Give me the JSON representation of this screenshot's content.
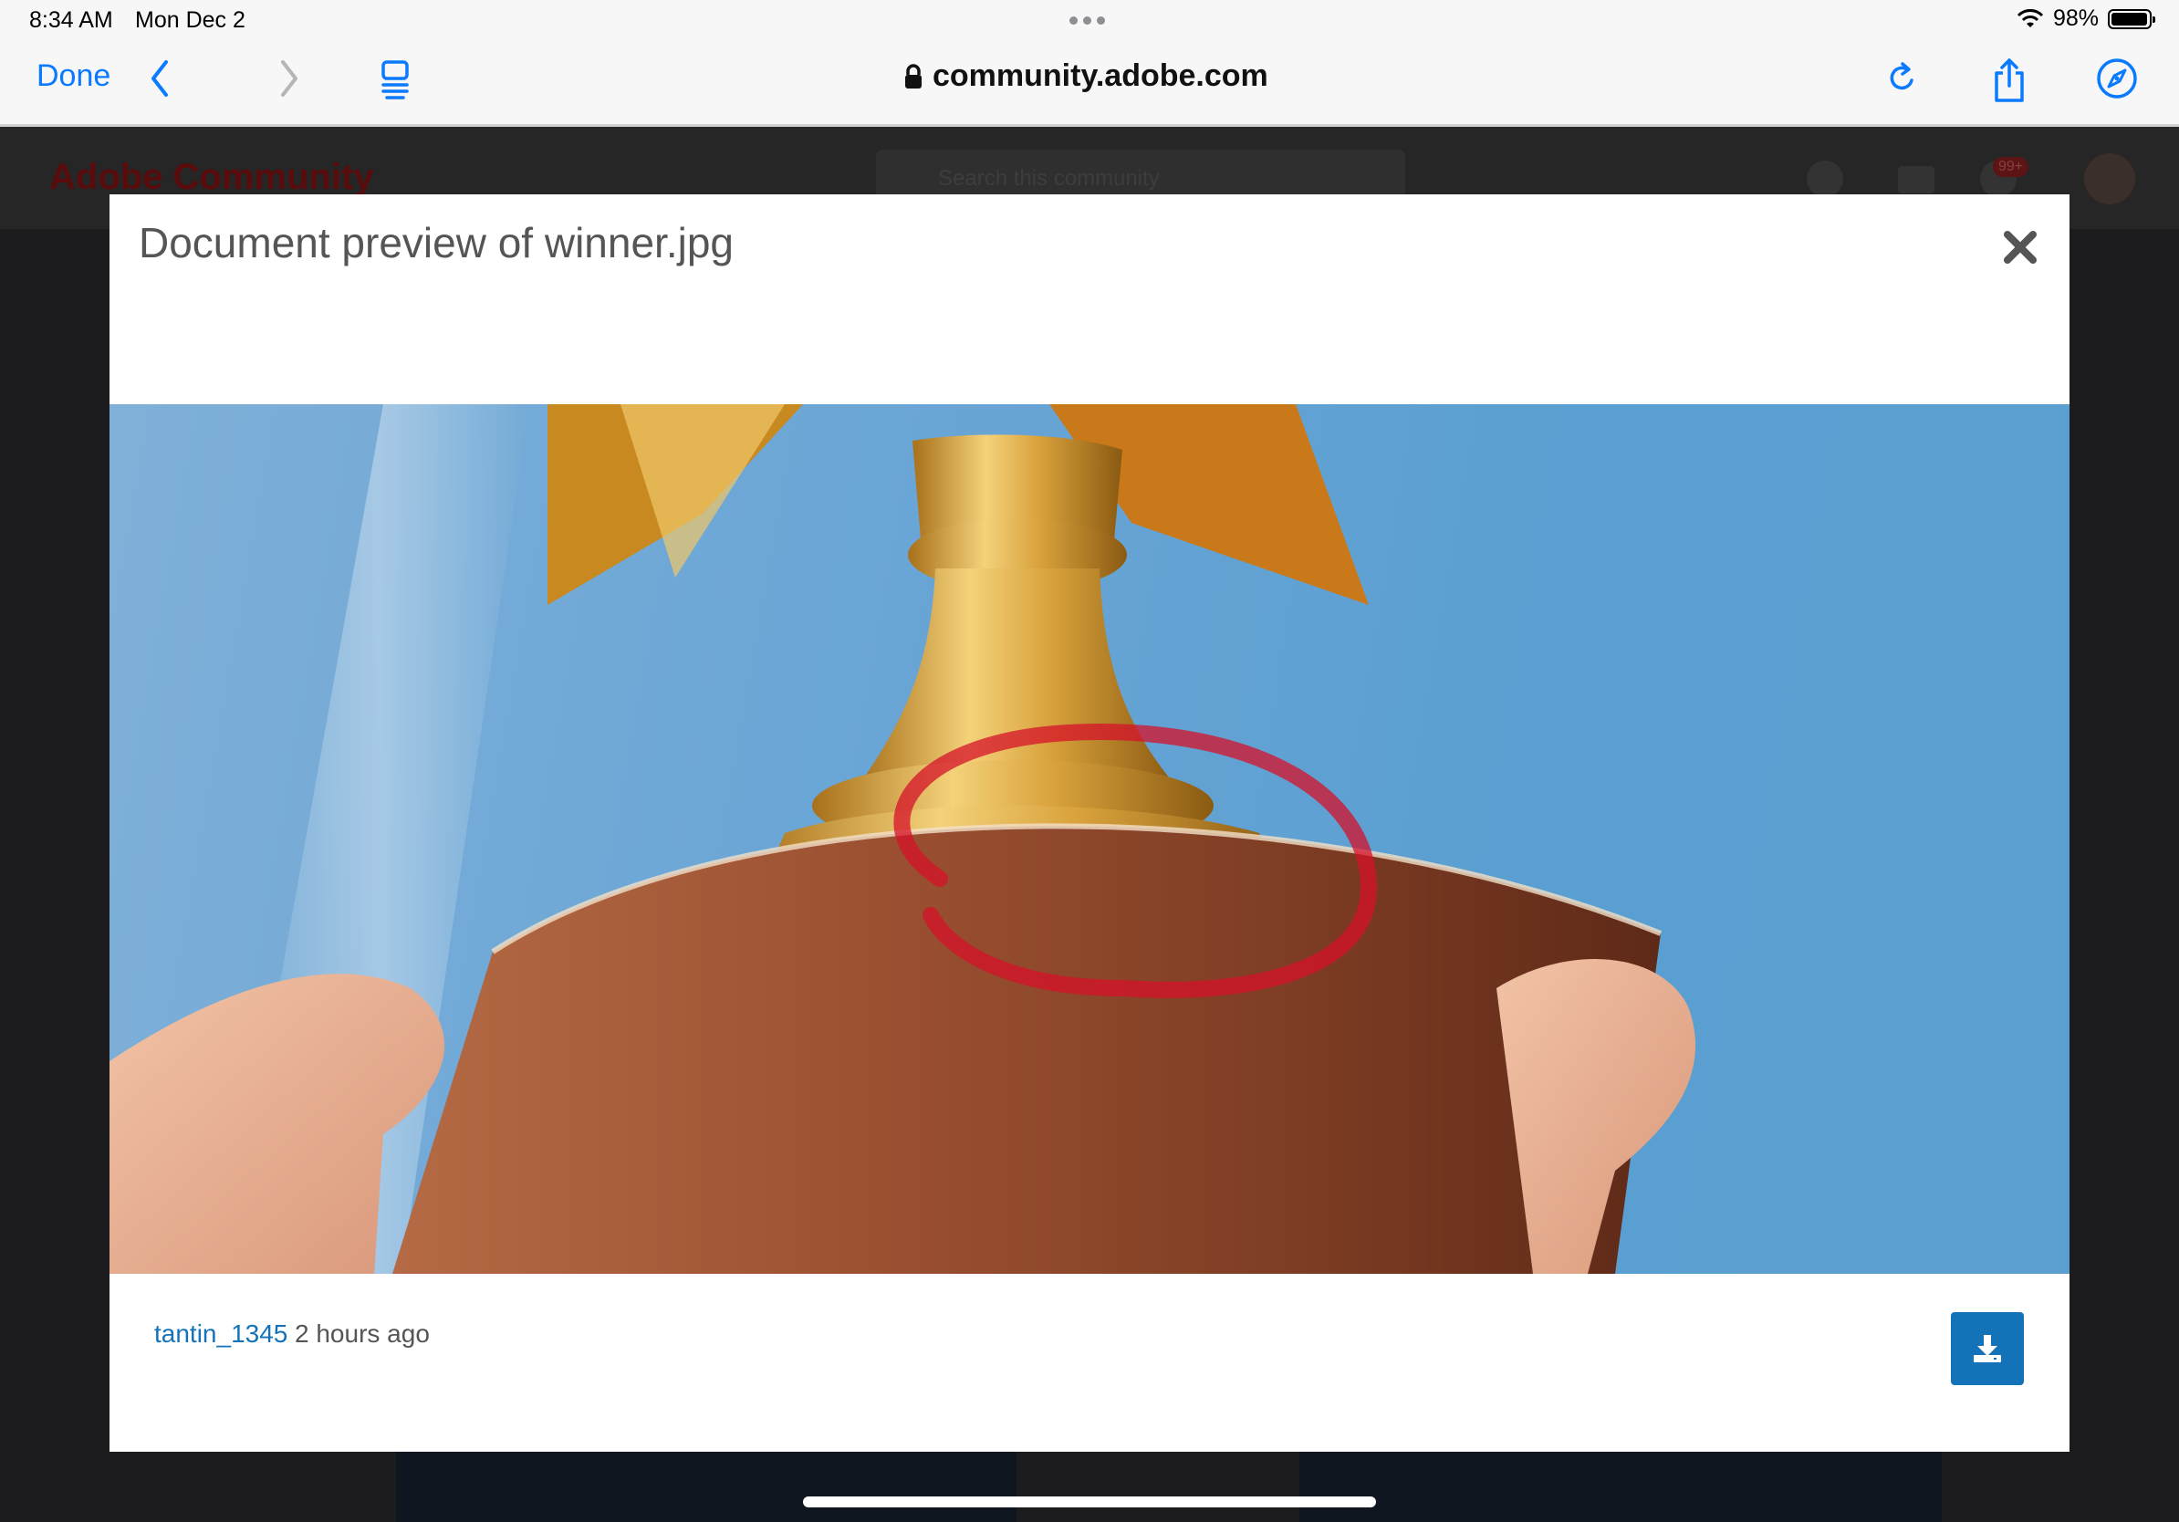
{
  "status_bar": {
    "time": "8:34 AM",
    "date": "Mon Dec 2",
    "battery": "98%",
    "battery_level": 0.98,
    "icons": [
      "wifi-icon",
      "battery-icon"
    ]
  },
  "toolbar": {
    "done_label": "Done",
    "url": "community.adobe.com",
    "icons": [
      "back-chevron-icon",
      "forward-chevron-icon",
      "tabs-icon",
      "lock-icon",
      "reload-icon",
      "share-icon",
      "compass-icon"
    ],
    "accent_color": "#0a7aff"
  },
  "background_page": {
    "logo": "Adobe Community",
    "search_placeholder": "Search this community",
    "notification_badge": "99+",
    "icons": [
      "globe-icon",
      "mail-icon",
      "bell-icon"
    ]
  },
  "modal": {
    "title": "Document preview of winner.jpg",
    "image_description_icon": "trophy-image",
    "author": "tantin_1345",
    "timestamp": "2 hours ago",
    "brand_color": "#1473b8",
    "icons": [
      "close-icon",
      "download-icon"
    ]
  }
}
